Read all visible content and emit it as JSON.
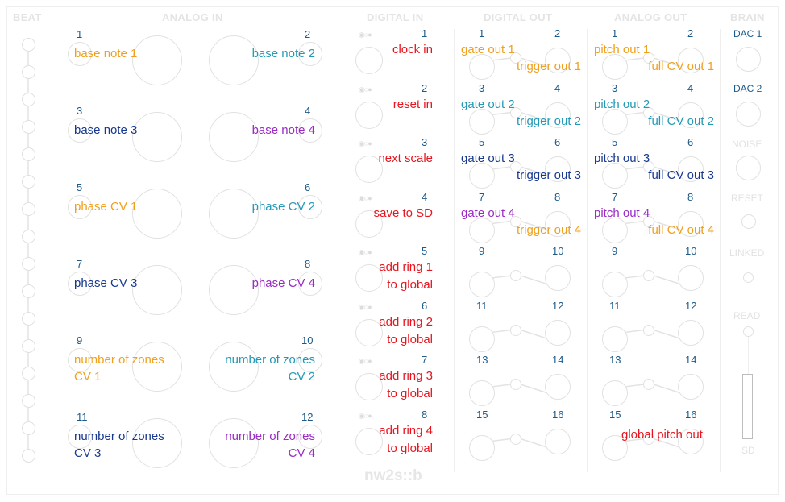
{
  "headers": {
    "beat": "BEAT",
    "analog_in": "ANALOG IN",
    "digital_in": "DIGITAL IN",
    "digital_out": "DIGITAL OUT",
    "analog_out": "ANALOG OUT",
    "brain": "BRAIN"
  },
  "colors": {
    "orange": "#f0a01e",
    "teal": "#2499b6",
    "navy": "#18388f",
    "purple": "#9a2bc4",
    "red": "#e8141e",
    "number_blue": "#1b5a8a"
  },
  "analog_in": [
    {
      "num": "1",
      "line1": "base note 1",
      "line2": "",
      "color": "orange"
    },
    {
      "num": "2",
      "line1": "base note 2",
      "line2": "",
      "color": "teal"
    },
    {
      "num": "3",
      "line1": "base note 3",
      "line2": "",
      "color": "navy"
    },
    {
      "num": "4",
      "line1": "base note 4",
      "line2": "",
      "color": "purple"
    },
    {
      "num": "5",
      "line1": "phase CV 1",
      "line2": "",
      "color": "orange"
    },
    {
      "num": "6",
      "line1": "phase CV 2",
      "line2": "",
      "color": "teal"
    },
    {
      "num": "7",
      "line1": "phase CV 3",
      "line2": "",
      "color": "navy"
    },
    {
      "num": "8",
      "line1": "phase CV 4",
      "line2": "",
      "color": "purple"
    },
    {
      "num": "9",
      "line1": "number of zones",
      "line2": "CV 1",
      "color": "orange"
    },
    {
      "num": "10",
      "line1": "number of zones",
      "line2": "CV 2",
      "color": "teal"
    },
    {
      "num": "11",
      "line1": "number of zones",
      "line2": "CV 3",
      "color": "navy"
    },
    {
      "num": "12",
      "line1": "number of zones",
      "line2": "CV 4",
      "color": "purple"
    }
  ],
  "digital_in": [
    {
      "num": "1",
      "line1": "clock in",
      "line2": ""
    },
    {
      "num": "2",
      "line1": "reset in",
      "line2": ""
    },
    {
      "num": "3",
      "line1": "next scale",
      "line2": ""
    },
    {
      "num": "4",
      "line1": "save to SD",
      "line2": ""
    },
    {
      "num": "5",
      "line1": "add ring 1",
      "line2": "to global"
    },
    {
      "num": "6",
      "line1": "add ring 2",
      "line2": "to global"
    },
    {
      "num": "7",
      "line1": "add ring 3",
      "line2": "to global"
    },
    {
      "num": "8",
      "line1": "add ring 4",
      "line2": "to global"
    }
  ],
  "digital_out": [
    {
      "num_a": "1",
      "num_b": "2",
      "label_a": "gate out 1",
      "label_b": "trigger out 1",
      "color_a": "orange",
      "color_b": "orange"
    },
    {
      "num_a": "3",
      "num_b": "4",
      "label_a": "gate out 2",
      "label_b": "trigger out 2",
      "color_a": "teal",
      "color_b": "teal"
    },
    {
      "num_a": "5",
      "num_b": "6",
      "label_a": "gate out 3",
      "label_b": "trigger out 3",
      "color_a": "navy",
      "color_b": "navy"
    },
    {
      "num_a": "7",
      "num_b": "8",
      "label_a": "gate out 4",
      "label_b": "trigger out 4",
      "color_a": "purple",
      "color_b": "orange"
    },
    {
      "num_a": "9",
      "num_b": "10",
      "label_a": "",
      "label_b": "",
      "color_a": "navy",
      "color_b": "navy"
    },
    {
      "num_a": "11",
      "num_b": "12",
      "label_a": "",
      "label_b": "",
      "color_a": "navy",
      "color_b": "navy"
    },
    {
      "num_a": "13",
      "num_b": "14",
      "label_a": "",
      "label_b": "",
      "color_a": "navy",
      "color_b": "navy"
    },
    {
      "num_a": "15",
      "num_b": "16",
      "label_a": "",
      "label_b": "",
      "color_a": "navy",
      "color_b": "navy"
    }
  ],
  "analog_out": [
    {
      "num_a": "1",
      "num_b": "2",
      "label_a": "pitch out 1",
      "label_b": "full CV out 1",
      "color_a": "orange",
      "color_b": "orange"
    },
    {
      "num_a": "3",
      "num_b": "4",
      "label_a": "pitch out 2",
      "label_b": "full CV out 2",
      "color_a": "teal",
      "color_b": "teal"
    },
    {
      "num_a": "5",
      "num_b": "6",
      "label_a": "pitch out 3",
      "label_b": "full CV out 3",
      "color_a": "navy",
      "color_b": "navy"
    },
    {
      "num_a": "7",
      "num_b": "8",
      "label_a": "pitch out 4",
      "label_b": "full CV out 4",
      "color_a": "purple",
      "color_b": "orange"
    },
    {
      "num_a": "9",
      "num_b": "10",
      "label_a": "",
      "label_b": "",
      "color_a": "navy",
      "color_b": "navy"
    },
    {
      "num_a": "11",
      "num_b": "12",
      "label_a": "",
      "label_b": "",
      "color_a": "navy",
      "color_b": "navy"
    },
    {
      "num_a": "13",
      "num_b": "14",
      "label_a": "",
      "label_b": "",
      "color_a": "navy",
      "color_b": "navy"
    },
    {
      "num_a": "15",
      "num_b": "16",
      "label_a": "",
      "label_b": "",
      "color_a": "navy",
      "color_b": "navy"
    }
  ],
  "global_pitch_out": "global pitch out",
  "brain": {
    "dac1": "DAC 1",
    "dac2": "DAC 2",
    "noise": "NOISE",
    "reset": "RESET",
    "linked": "LINKED",
    "read": "READ",
    "sd": "SD"
  },
  "brand": "nw2s::b",
  "beat_led_count": 16
}
